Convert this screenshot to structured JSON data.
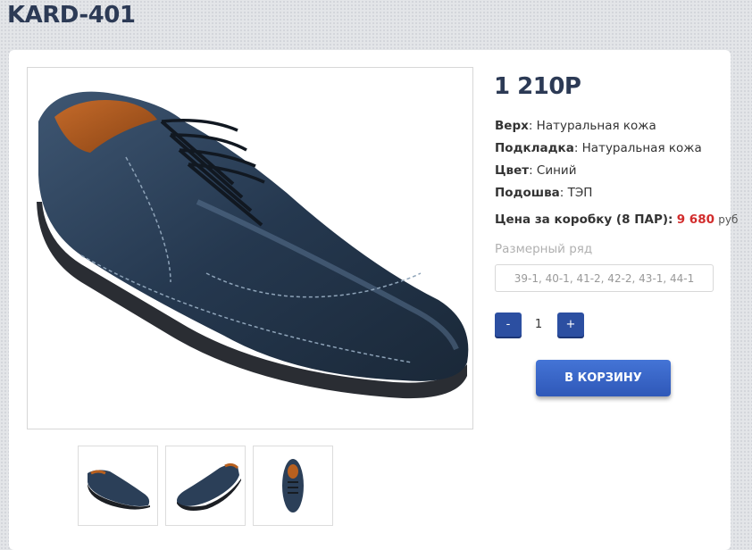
{
  "product": {
    "title": "KARD-401",
    "price": "1 210Р",
    "attributes": [
      {
        "label": "Верх",
        "value": ": Натуральная кожа"
      },
      {
        "label": "Подкладка",
        "value": ": Натуральная кожа"
      },
      {
        "label": "Цвет",
        "value": ": Синий"
      },
      {
        "label": "Подошва",
        "value": ": ТЭП"
      }
    ],
    "box_price": {
      "label": "Цена за коробку (8 ПАР):",
      "value": "9 680",
      "currency": "руб"
    },
    "size_row": {
      "label": "Размерный ряд",
      "value": "39-1, 40-1, 41-2, 42-2, 43-1, 44-1"
    },
    "quantity": {
      "minus": "-",
      "value": "1",
      "plus": "+"
    },
    "add_to_cart": "В КОРЗИНУ"
  },
  "images": {
    "main": "shoe-side-view",
    "thumbnails": [
      "shoe-side-view",
      "shoe-angle-view",
      "shoe-top-view"
    ]
  },
  "colors": {
    "accent": "#2c4fa1",
    "price_red": "#d22c2c",
    "title": "#2c3a55"
  }
}
